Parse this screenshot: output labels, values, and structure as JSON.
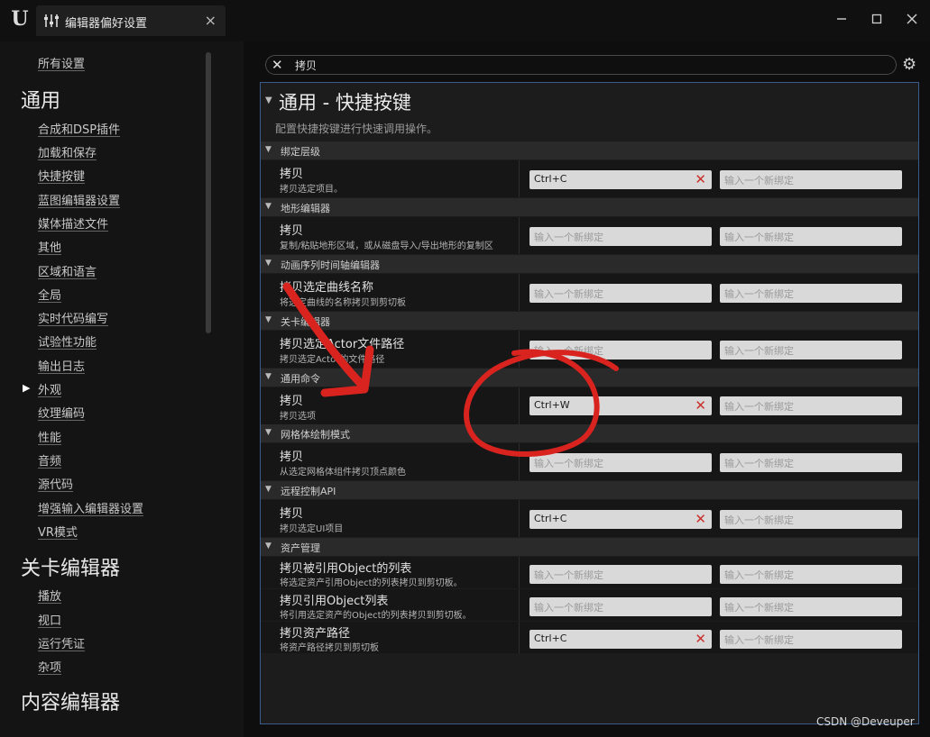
{
  "window": {
    "tab_title": "编辑器偏好设置",
    "tab_close": "×",
    "logo": "U"
  },
  "search": {
    "value": "拷贝",
    "clear_icon": "close-icon"
  },
  "sidebar": {
    "all_settings": "所有设置",
    "sections": [
      {
        "heading": "通用",
        "items": [
          "合成和DSP插件",
          "加载和保存",
          "快捷按键",
          "蓝图编辑器设置",
          "媒体描述文件",
          "其他",
          "区域和语言",
          "全局",
          "实时代码编写",
          "试验性功能",
          "输出日志",
          "外观",
          "纹理编码",
          "性能",
          "音频",
          "源代码",
          "增强输入编辑器设置",
          "VR模式"
        ]
      },
      {
        "heading": "关卡编辑器",
        "items": [
          "播放",
          "视口",
          "运行凭证",
          "杂项"
        ]
      },
      {
        "heading": "内容编辑器",
        "items": []
      }
    ]
  },
  "main": {
    "title": "通用 - 快捷按键",
    "description": "配置快捷按键进行快速调用操作。",
    "placeholder": "输入一个新绑定",
    "categories": [
      {
        "name": "绑定层级",
        "rows": [
          {
            "title": "拷贝",
            "desc": "拷贝选定项目。",
            "binding1": "Ctrl+C"
          }
        ]
      },
      {
        "name": "地形编辑器",
        "rows": [
          {
            "title": "拷贝",
            "desc": "复制/粘贴地形区域，或从磁盘导入/导出地形的复制区",
            "binding1": ""
          }
        ]
      },
      {
        "name": "动画序列时间轴编辑器",
        "rows": [
          {
            "title": "拷贝选定曲线名称",
            "desc": "将选定曲线的名称拷贝到剪切板",
            "binding1": ""
          }
        ]
      },
      {
        "name": "关卡编辑器",
        "rows": [
          {
            "title": "拷贝选定Actor文件路径",
            "desc": "拷贝选定Actor的文件路径",
            "binding1": ""
          }
        ]
      },
      {
        "name": "通用命令",
        "rows": [
          {
            "title": "拷贝",
            "desc": "拷贝选项",
            "binding1": "Ctrl+W"
          }
        ]
      },
      {
        "name": "网格体绘制模式",
        "rows": [
          {
            "title": "拷贝",
            "desc": "从选定网格体组件拷贝顶点颜色",
            "binding1": ""
          }
        ]
      },
      {
        "name": "远程控制API",
        "rows": [
          {
            "title": "拷贝",
            "desc": "拷贝选定UI项目",
            "binding1": "Ctrl+C"
          }
        ]
      },
      {
        "name": "资产管理",
        "rows": [
          {
            "title": "拷贝被引用Object的列表",
            "desc": "将选定资产引用Object的列表拷贝到剪切板。",
            "binding1": ""
          },
          {
            "title": "拷贝引用Object列表",
            "desc": "将引用选定资产的Object的列表拷贝到剪切板。",
            "binding1": ""
          },
          {
            "title": "拷贝资产路径",
            "desc": "将资产路径拷贝到剪切板",
            "binding1": "Ctrl+C"
          }
        ]
      }
    ]
  },
  "watermark": "CSDN @Deveuper",
  "colors": {
    "annotation": "#d9231f",
    "panel_border": "#3b5c8a",
    "clear_binding": "#c9302c"
  }
}
